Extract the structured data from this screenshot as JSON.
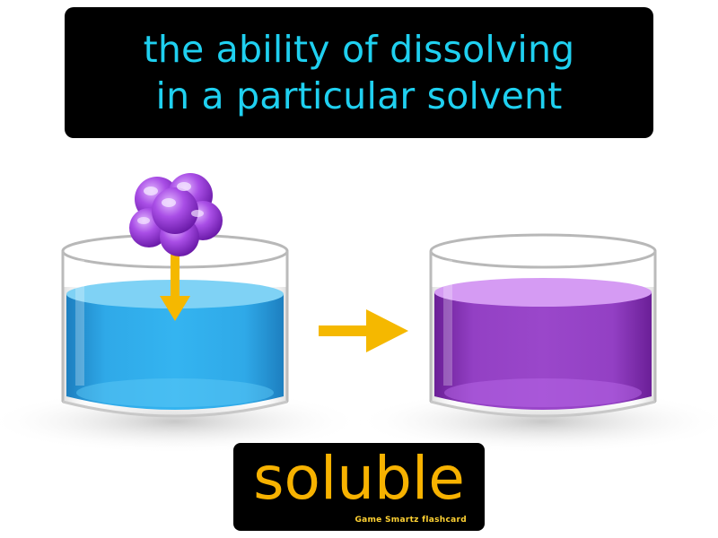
{
  "definition": {
    "line1": "the ability of dissolving",
    "line2": "in a particular solvent"
  },
  "term": {
    "word": "soluble"
  },
  "brand": {
    "text": "Game Smartz flashcard"
  },
  "colors": {
    "definition_text": "#1fd0f0",
    "term_text": "#f7b200",
    "solvent_liquid": "#27a6e4",
    "solution_liquid": "#8c35b8",
    "solute_particles": "#a03fe0",
    "arrow": "#f5b800"
  },
  "icons": {
    "solute": "purple-molecule-cluster-icon",
    "before_container": "beaker-with-blue-liquid-icon",
    "after_container": "beaker-with-purple-liquid-icon",
    "transition": "right-arrow-icon"
  }
}
